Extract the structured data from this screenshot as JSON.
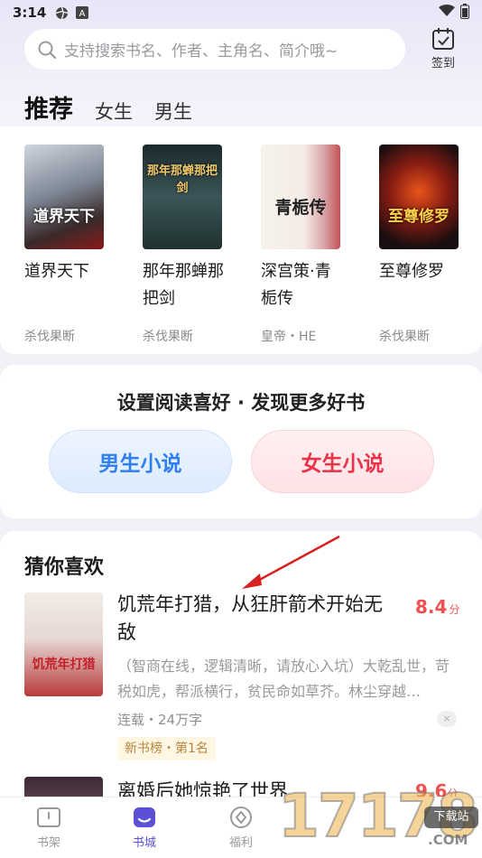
{
  "status": {
    "time": "3:14"
  },
  "search": {
    "placeholder": "支持搜索书名、作者、主角名、简介哦~",
    "checkin_label": "签到"
  },
  "tabs": [
    {
      "label": "推荐",
      "active": true
    },
    {
      "label": "女生",
      "active": false
    },
    {
      "label": "男生",
      "active": false
    }
  ],
  "books": [
    {
      "title": "道界天下",
      "author": "杀伐果断",
      "cover_text": "道界天下"
    },
    {
      "title": "那年那蝉那把剑",
      "author": "杀伐果断",
      "cover_text": "那年那蝉那把剑"
    },
    {
      "title": "深宫策·青栀传",
      "author": "皇帝・HE",
      "cover_text": "青栀传"
    },
    {
      "title": "至尊修罗",
      "author": "杀伐果断",
      "cover_text": "至尊修罗"
    }
  ],
  "preference": {
    "title": "设置阅读喜好 · 发现更多好书",
    "male_label": "男生小说",
    "female_label": "女生小说"
  },
  "guess": {
    "title": "猜你喜欢",
    "items": [
      {
        "title": "饥荒年打猎，从狂肝箭术开始无敌",
        "score": "8.4",
        "score_unit": "分",
        "desc": "（智商在线，逻辑清晰，请放心入坑）大乾乱世，苛税如虎，帮派横行，贫民命如草芥。林尘穿越…",
        "meta": "连载・24万字",
        "badge": "新书榜・第1名",
        "cover_text": "饥荒年打猎",
        "close": "×"
      },
      {
        "title": "离婚后她惊艳了世界",
        "score": "9.6",
        "score_unit": "分"
      }
    ]
  },
  "nav": [
    {
      "label": "书架",
      "active": false
    },
    {
      "label": "书城",
      "active": true
    },
    {
      "label": "福利",
      "active": false
    }
  ],
  "watermark": {
    "number": "17178",
    "box": "下载站",
    "domain": ".COM"
  },
  "colors": {
    "accent": "#6a5bd8",
    "score": "#ef5151",
    "male": "#2e7ff0",
    "female": "#e8334a"
  }
}
